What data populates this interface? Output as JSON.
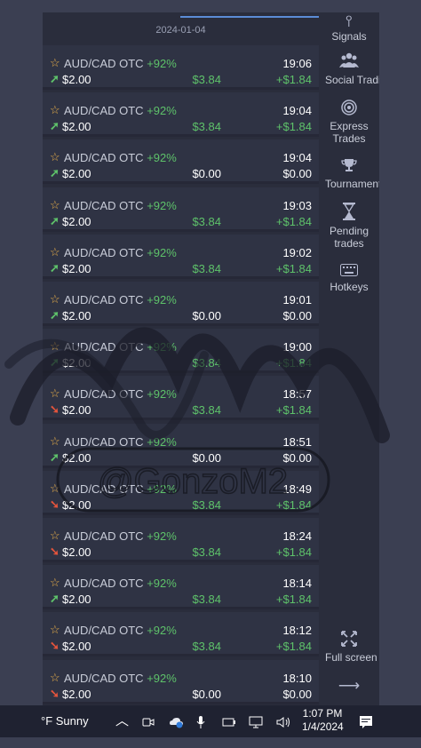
{
  "history": {
    "date": "2024-01-04",
    "trades": [
      {
        "asset": "AUD/CAD OTC",
        "percent": "+92%",
        "direction": "up",
        "stake": "$2.00",
        "payout": "$3.84",
        "time": "19:06",
        "profit": "+$1.84",
        "result": "win"
      },
      {
        "asset": "AUD/CAD OTC",
        "percent": "+92%",
        "direction": "up",
        "stake": "$2.00",
        "payout": "$3.84",
        "time": "19:04",
        "profit": "+$1.84",
        "result": "win"
      },
      {
        "asset": "AUD/CAD OTC",
        "percent": "+92%",
        "direction": "up",
        "stake": "$2.00",
        "payout": "$0.00",
        "time": "19:04",
        "profit": "$0.00",
        "result": "loss"
      },
      {
        "asset": "AUD/CAD OTC",
        "percent": "+92%",
        "direction": "up",
        "stake": "$2.00",
        "payout": "$3.84",
        "time": "19:03",
        "profit": "+$1.84",
        "result": "win"
      },
      {
        "asset": "AUD/CAD OTC",
        "percent": "+92%",
        "direction": "up",
        "stake": "$2.00",
        "payout": "$3.84",
        "time": "19:02",
        "profit": "+$1.84",
        "result": "win"
      },
      {
        "asset": "AUD/CAD OTC",
        "percent": "+92%",
        "direction": "up",
        "stake": "$2.00",
        "payout": "$0.00",
        "time": "19:01",
        "profit": "$0.00",
        "result": "loss"
      },
      {
        "asset": "AUD/CAD OTC",
        "percent": "+92%",
        "direction": "up",
        "stake": "$2.00",
        "payout": "$3.84",
        "time": "19:00",
        "profit": "+$1.84",
        "result": "win"
      },
      {
        "asset": "AUD/CAD OTC",
        "percent": "+92%",
        "direction": "down",
        "stake": "$2.00",
        "payout": "$3.84",
        "time": "18:57",
        "profit": "+$1.84",
        "result": "win"
      },
      {
        "asset": "AUD/CAD OTC",
        "percent": "+92%",
        "direction": "up",
        "stake": "$2.00",
        "payout": "$0.00",
        "time": "18:51",
        "profit": "$0.00",
        "result": "loss"
      },
      {
        "asset": "AUD/CAD OTC",
        "percent": "+92%",
        "direction": "down",
        "stake": "$2.00",
        "payout": "$3.84",
        "time": "18:49",
        "profit": "+$1.84",
        "result": "win"
      },
      {
        "asset": "AUD/CAD OTC",
        "percent": "+92%",
        "direction": "down",
        "stake": "$2.00",
        "payout": "$3.84",
        "time": "18:24",
        "profit": "+$1.84",
        "result": "win"
      },
      {
        "asset": "AUD/CAD OTC",
        "percent": "+92%",
        "direction": "up",
        "stake": "$2.00",
        "payout": "$3.84",
        "time": "18:14",
        "profit": "+$1.84",
        "result": "win"
      },
      {
        "asset": "AUD/CAD OTC",
        "percent": "+92%",
        "direction": "down",
        "stake": "$2.00",
        "payout": "$3.84",
        "time": "18:12",
        "profit": "+$1.84",
        "result": "win"
      },
      {
        "asset": "AUD/CAD OTC",
        "percent": "+92%",
        "direction": "down",
        "stake": "$2.00",
        "payout": "$0.00",
        "time": "18:10",
        "profit": "$0.00",
        "result": "loss"
      }
    ]
  },
  "sidebar": {
    "signals": {
      "label": "Signals",
      "icon": "signal-icon"
    },
    "social": {
      "label": "Social Trading",
      "icon": "users-icon"
    },
    "express": {
      "label": "Express Trades",
      "line1": "Express",
      "line2": "Trades",
      "icon": "target-icon"
    },
    "tournaments": {
      "label": "Tournaments",
      "icon": "trophy-icon"
    },
    "pending": {
      "label": "Pending trades",
      "line1": "Pending",
      "line2": "trades",
      "icon": "hourglass-icon"
    },
    "hotkeys": {
      "label": "Hotkeys",
      "icon": "keyboard-icon"
    },
    "fullscreen": {
      "label": "Full screen",
      "icon": "expand-icon"
    },
    "collapse": {
      "icon": "arrow-right-icon"
    }
  },
  "taskbar": {
    "weather": "°F  Sunny",
    "time": "1:07 PM",
    "date": "1/4/2024"
  },
  "watermark": {
    "text": "@GonzoM2"
  },
  "colors": {
    "win": "#5ec26a",
    "loss": "#ffffff",
    "down_arrow": "#e3543c",
    "star": "#f0b44a",
    "accent": "#5b8cd6"
  }
}
